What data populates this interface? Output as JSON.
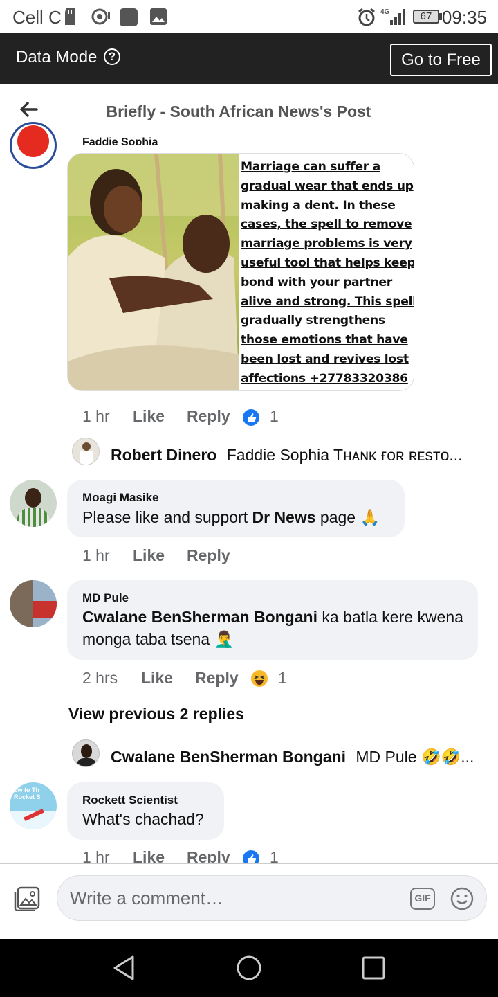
{
  "status_bar": {
    "carrier": "Cell C",
    "network": "4G",
    "battery": "67",
    "time": "09:35"
  },
  "data_bar": {
    "label": "Data Mode",
    "help_glyph": "?",
    "go_free": "Go to Free"
  },
  "header": {
    "title": "Briefly - South African News's Post"
  },
  "post_image": {
    "caption_lines": [
      "Marriage can suffer a",
      "gradual wear that ends up",
      "making a dent. In these",
      "cases, the spell to remove",
      "marriage problems is very",
      "useful tool that helps keep",
      "bond with your partner",
      "alive and strong. This spell",
      "gradually strengthens",
      "those emotions that have",
      "been lost and revives lost",
      "affections +27783320386"
    ]
  },
  "comments": [
    {
      "name": "Faddie Sophia",
      "time": "1 hr",
      "like": "Like",
      "reply": "Reply",
      "reaction_count": "1",
      "reply_preview": {
        "author": "Robert Dinero",
        "text": "Faddie Sophia Tʜᴀɴᴋ ғᴏʀ ʀᴇsᴛᴏ..."
      }
    },
    {
      "name": "Moagi Masike",
      "text_before": "Please like and support ",
      "text_bold": "Dr News",
      "text_after": " page 🙏",
      "time": "1 hr",
      "like": "Like",
      "reply": "Reply"
    },
    {
      "name": "MD Pule",
      "mention": "Cwalane BenSherman Bongani",
      "text_line1_after": " ka batla kere kwena",
      "text_line2": "monga taba tsena 🤦‍♂️",
      "time": "2 hrs",
      "like": "Like",
      "reply": "Reply",
      "reaction_count": "1",
      "view_previous": "View previous 2 replies",
      "reply_preview": {
        "author": "Cwalane BenSherman Bongani",
        "text": "MD Pule 🤣🤣..."
      }
    },
    {
      "name": "Rockett Scientist",
      "avatar_text": "ow to Th Rocket S",
      "text": "What's chachad?",
      "time": "1 hr",
      "like": "Like",
      "reply": "Reply",
      "reaction_count": "1"
    }
  ],
  "composer": {
    "placeholder": "Write a comment…",
    "gif_label": "GIF"
  },
  "colors": {
    "data_bar_bg": "#222222",
    "like_blue": "#1877f2",
    "bubble_bg": "#f0f2f5"
  }
}
